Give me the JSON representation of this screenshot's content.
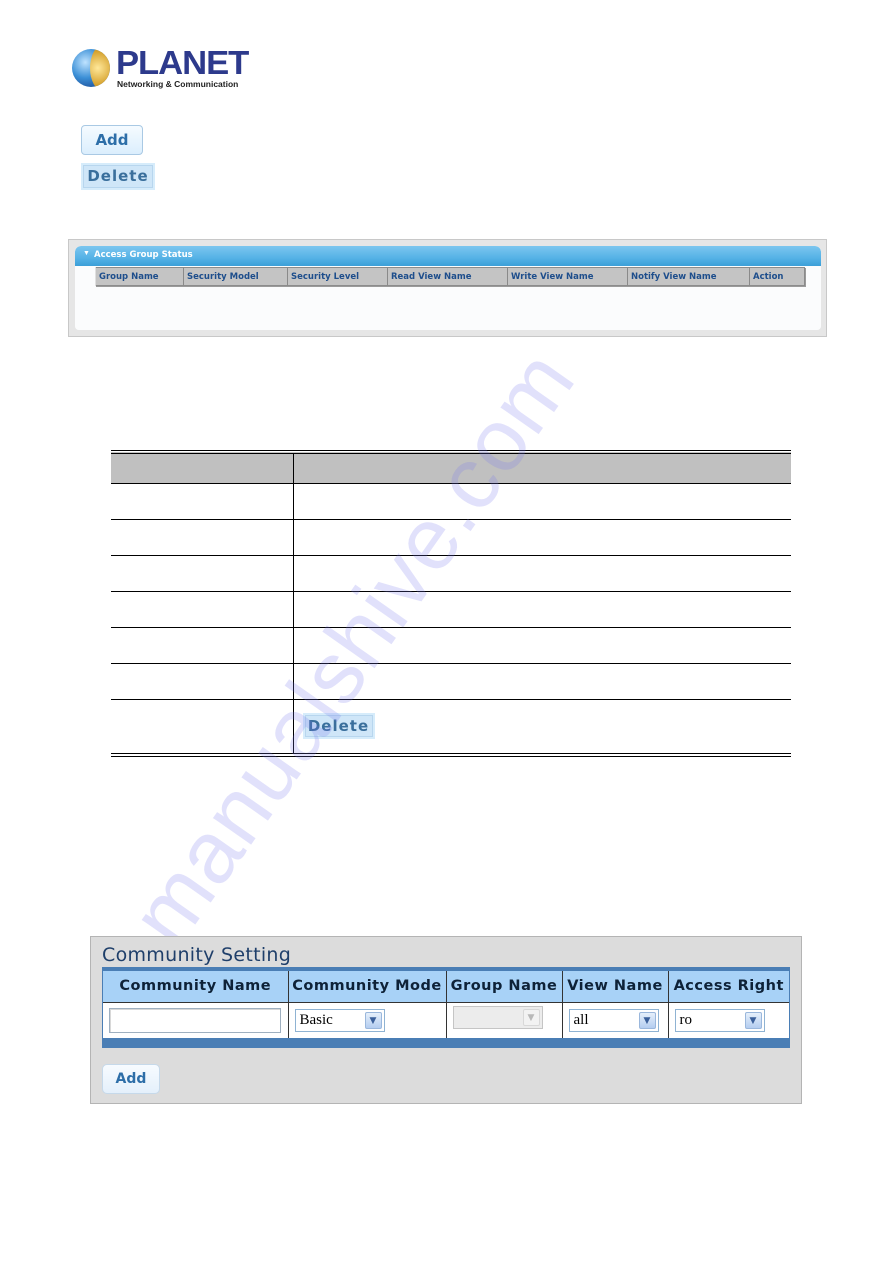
{
  "logo": {
    "brand": "PLANET",
    "tagline": "Networking & Communication"
  },
  "buttons": {
    "add_label": "Add",
    "delete_label": "Delete"
  },
  "access_group_status": {
    "title": "Access Group Status",
    "columns": [
      "Group Name",
      "Security Model",
      "Security Level",
      "Read View Name",
      "Write View Name",
      "Notify View Name",
      "Action"
    ]
  },
  "description_table": {
    "header": [
      "",
      ""
    ],
    "rows": [
      [
        "",
        ""
      ],
      [
        "",
        ""
      ],
      [
        "",
        ""
      ],
      [
        "",
        ""
      ],
      [
        "",
        ""
      ],
      [
        "",
        ""
      ]
    ],
    "last_row_button": "Delete"
  },
  "watermark": "manualshive.com",
  "community_setting": {
    "title": "Community Setting",
    "columns": [
      "Community Name",
      "Community Mode",
      "Group Name",
      "View Name",
      "Access Right"
    ],
    "row": {
      "community_name": "",
      "community_mode": "Basic",
      "group_name": "",
      "view_name": "all",
      "access_right": "ro"
    },
    "add_label": "Add"
  },
  "colors": {
    "panel_header_blue": "#55b2e6",
    "table_header_blue": "#a8d2f7",
    "table_frame_blue": "#4a7eb5",
    "button_text_blue": "#2d6ea8",
    "logo_navy": "#2d3a8c"
  }
}
